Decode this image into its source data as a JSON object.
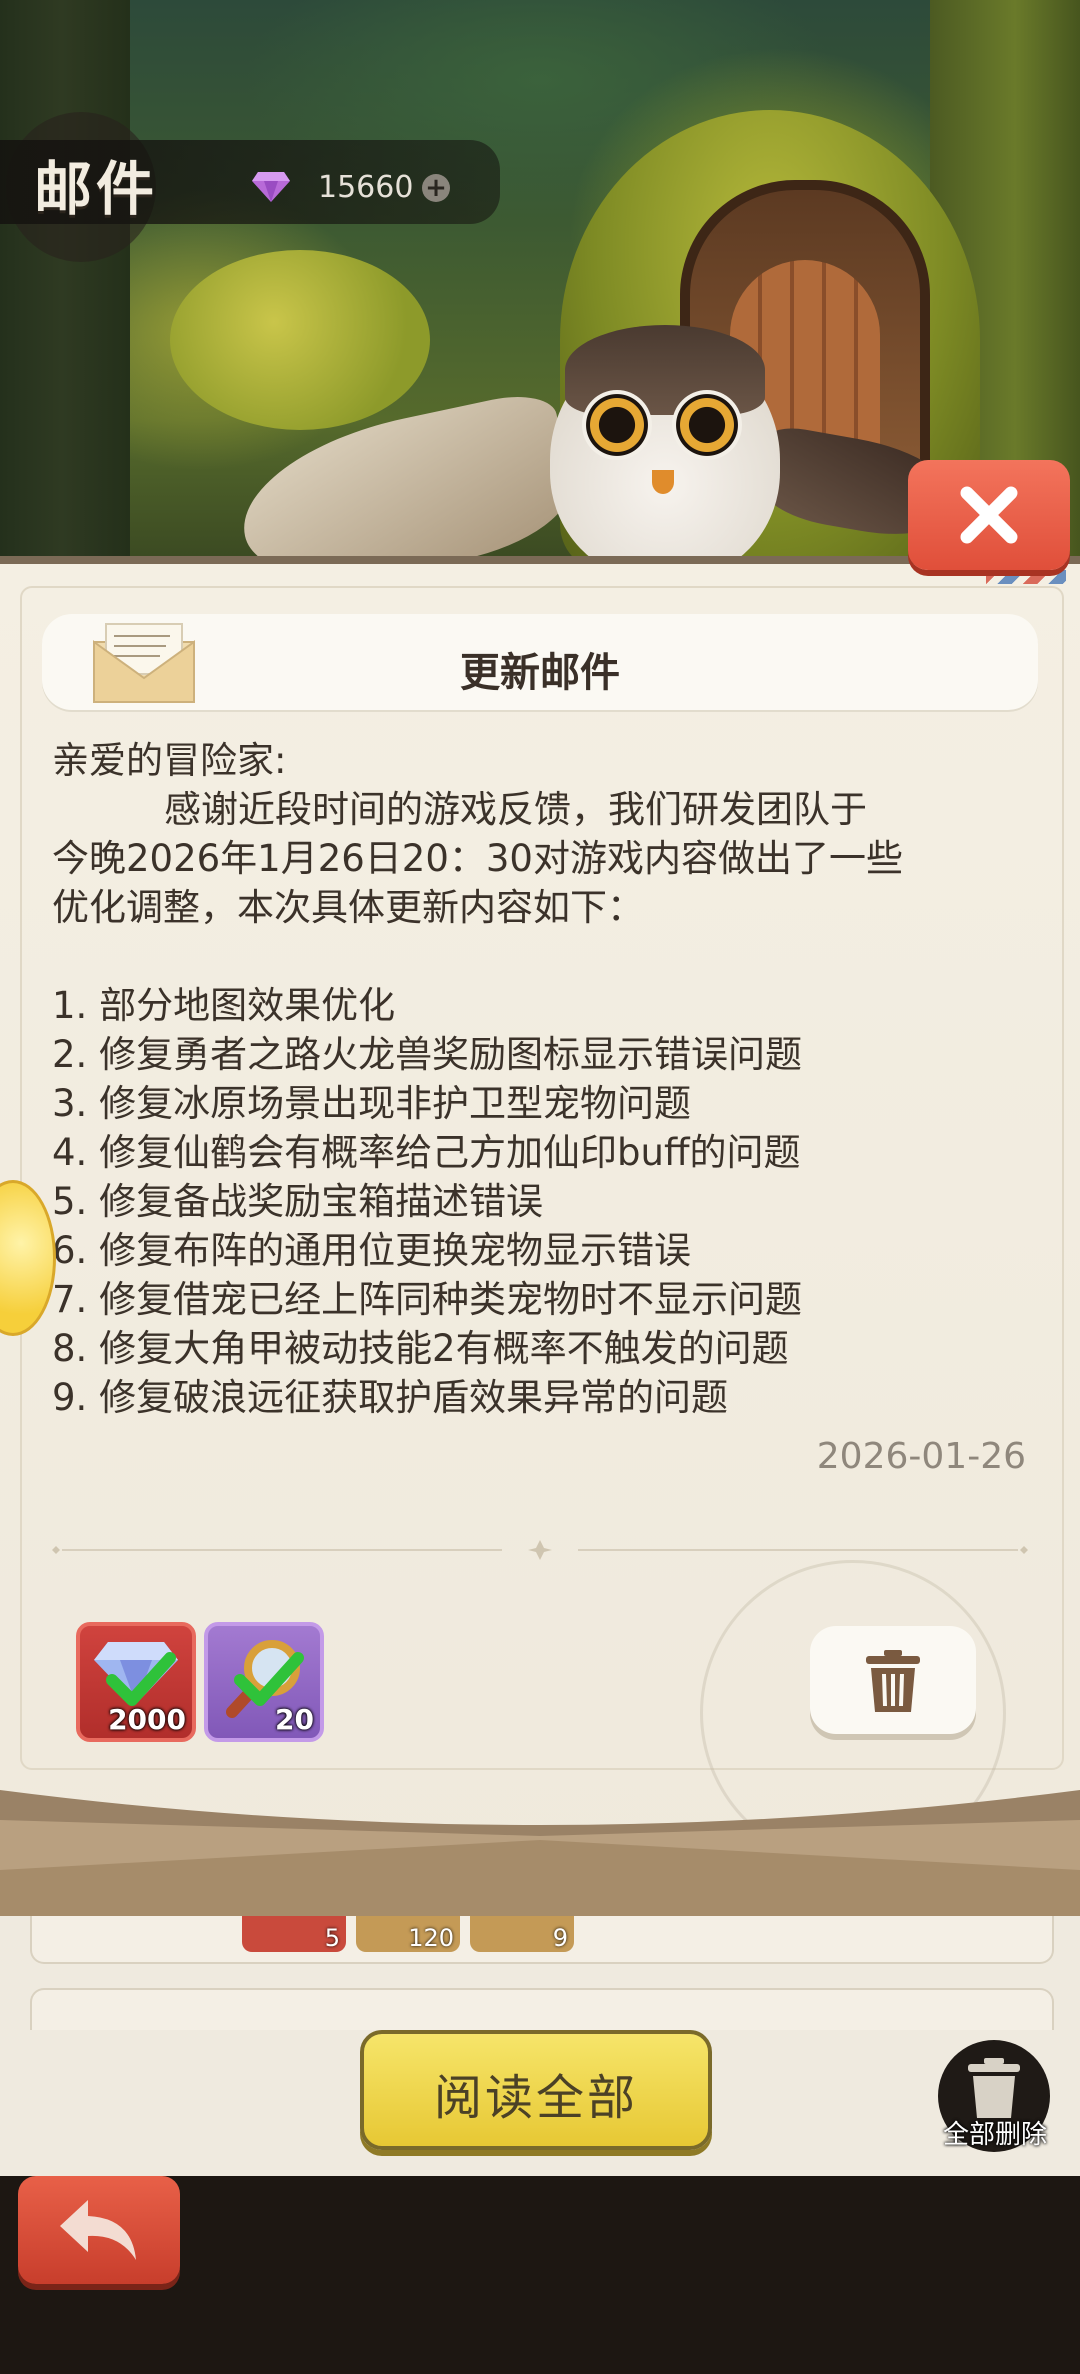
{
  "header": {
    "title": "邮件",
    "gem_count": "15660",
    "plus_icon": "+"
  },
  "mail": {
    "subject": "更新邮件",
    "greeting": "亲爱的冒险家:",
    "paragraph_1": "感谢近段时间的游戏反馈，我们研发团队于",
    "paragraph_2": "今晚2026年1月26日20：30对游戏内容做出了一些",
    "paragraph_3": "优化调整，本次具体更新内容如下：",
    "items": [
      "1. 部分地图效果优化",
      "2. 修复勇者之路火龙兽奖励图标显示错误问题",
      "3. 修复冰原场景出现非护卫型宠物问题",
      "4. 修复仙鹤会有概率给己方加仙印buff的问题",
      "5. 修复备战奖励宝箱描述错误",
      "6. 修复布阵的通用位更换宠物显示错误",
      "7. 修复借宠已经上阵同种类宠物时不显示问题",
      "8. 修复大角甲被动技能2有概率不触发的问题",
      "9. 修复破浪远征获取护盾效果异常的问题"
    ],
    "date": "2026-01-26"
  },
  "rewards": [
    {
      "icon": "diamond-icon",
      "qty": "2000",
      "claimed": true
    },
    {
      "icon": "magnifier-icon",
      "qty": "20",
      "claimed": true
    }
  ],
  "list_preview": {
    "item_counts": [
      "5",
      "120",
      "9"
    ]
  },
  "footer": {
    "read_all_label": "阅读全部",
    "delete_all_label": "全部删除"
  },
  "colors": {
    "close_button": "#e8583f",
    "read_all_button": "#f0d84a",
    "panel_background": "#f4efe3"
  }
}
